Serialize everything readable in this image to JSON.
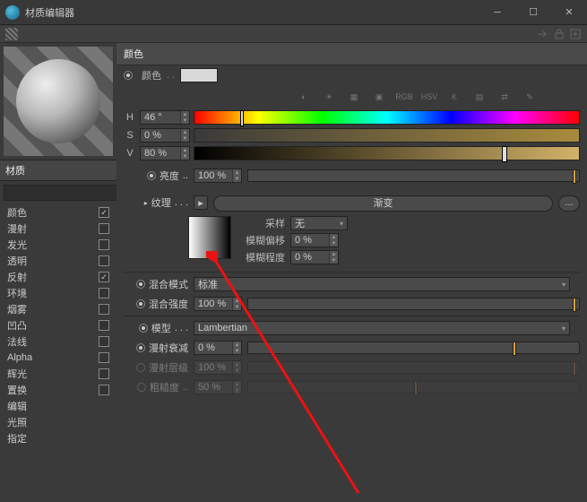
{
  "window": {
    "title": "材质编辑器"
  },
  "sidebar": {
    "material_label": "材质",
    "search": {
      "value": "",
      "placeholder": ""
    },
    "channels": [
      {
        "label": "颜色",
        "checked": true,
        "active": true
      },
      {
        "label": "漫射",
        "checked": false
      },
      {
        "label": "发光",
        "checked": false
      },
      {
        "label": "透明",
        "checked": false
      },
      {
        "label": "反射",
        "checked": true
      },
      {
        "label": "环境",
        "checked": false
      },
      {
        "label": "烟雾",
        "checked": false
      },
      {
        "label": "凹凸",
        "checked": false
      },
      {
        "label": "法线",
        "checked": false
      },
      {
        "label": "Alpha",
        "checked": false
      },
      {
        "label": "辉光",
        "checked": false
      },
      {
        "label": "置换",
        "checked": false
      },
      {
        "label": "编辑",
        "checked": null
      },
      {
        "label": "光照",
        "checked": null
      },
      {
        "label": "指定",
        "checked": null
      }
    ]
  },
  "panel": {
    "title": "颜色",
    "color_label": "颜色",
    "color_hex": "#d9d9d9",
    "iconrow": [
      "wheel",
      "sun",
      "grid",
      "img",
      "RGB",
      "HSV",
      "K",
      "grad",
      "swap",
      "pick"
    ],
    "hsv": {
      "h": {
        "label": "H",
        "value": "46 °"
      },
      "s": {
        "label": "S",
        "value": "0 %"
      },
      "v": {
        "label": "V",
        "value": "80 %"
      }
    },
    "brightness": {
      "label": "亮度",
      "value": "100 %",
      "mark": 100
    },
    "texture": {
      "label": "纹理",
      "button": "渐变",
      "more": "..."
    },
    "tex_params": {
      "sample": {
        "label": "采样",
        "value": "无"
      },
      "blur_offset": {
        "label": "模糊偏移",
        "value": "0 %"
      },
      "blur_scale": {
        "label": "模糊程度",
        "value": "0 %"
      }
    },
    "blend_mode": {
      "label": "混合模式",
      "value": "标准"
    },
    "blend_strength": {
      "label": "混合强度",
      "value": "100 %",
      "mark": 100
    },
    "model": {
      "label": "模型",
      "value": "Lambertian"
    },
    "diffuse_falloff": {
      "label": "漫射衰减",
      "value": "0 %",
      "mark": 80
    },
    "diffuse_levels": {
      "label": "漫射层级",
      "value": "100 %",
      "mark": 100,
      "enabled": false
    },
    "roughness": {
      "label": "粗糙度",
      "value": "50 %",
      "mark": 50,
      "enabled": false
    }
  }
}
